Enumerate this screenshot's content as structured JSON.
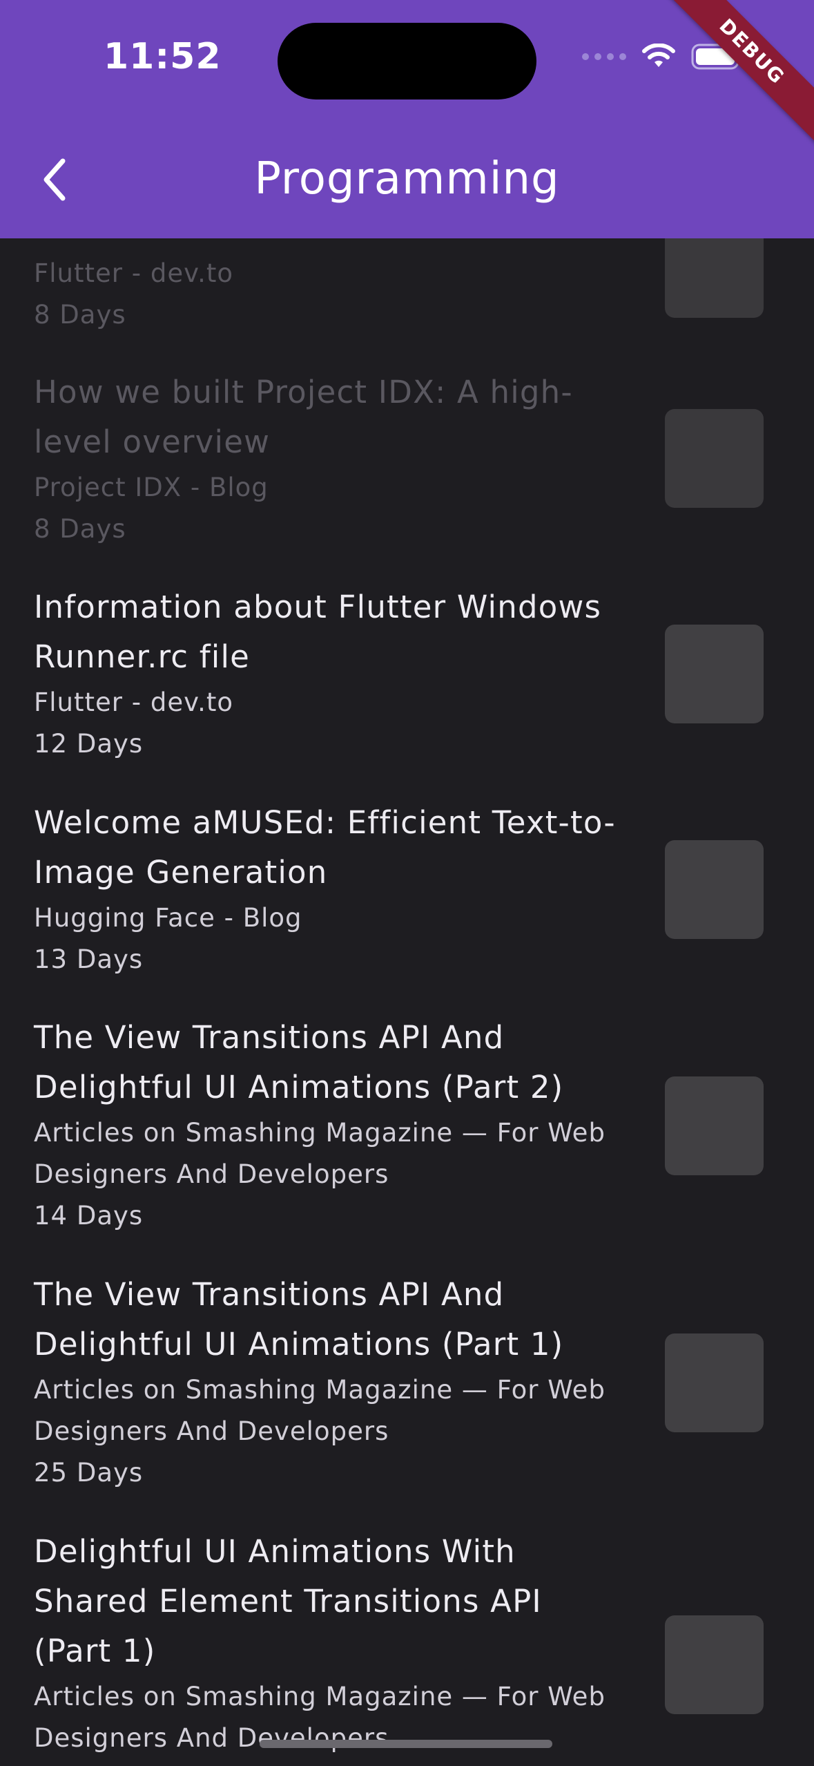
{
  "status_bar": {
    "time": "11:52"
  },
  "debug_banner": "DEBUG",
  "app_bar": {
    "title": "Programming"
  },
  "articles": [
    {
      "title": "",
      "source": "Flutter - dev.to",
      "age": "8 Days"
    },
    {
      "title": "How we built Project IDX: A high-level overview",
      "source": "Project IDX - Blog",
      "age": "8 Days"
    },
    {
      "title": "Information about Flutter Windows Runner.rc file",
      "source": "Flutter - dev.to",
      "age": "12 Days"
    },
    {
      "title": "Welcome aMUSEd: Efficient Text-to-Image Generation",
      "source": "Hugging Face - Blog",
      "age": "13 Days"
    },
    {
      "title": "The View Transitions API And Delightful UI Animations (Part 2)",
      "source": "Articles on Smashing Magazine — For Web Designers And Developers",
      "age": "14 Days"
    },
    {
      "title": "The View Transitions API And Delightful UI Animations (Part 1)",
      "source": "Articles on Smashing Magazine — For Web Designers And Developers",
      "age": "25 Days"
    },
    {
      "title": "Delightful UI Animations With Shared Element Transitions API (Part 1)",
      "source": "Articles on Smashing Magazine — For Web Designers And Developers",
      "age": ""
    }
  ],
  "colors": {
    "app_bar": "#6f46bd",
    "background": "#1e1d21",
    "thumbnail": "#414043",
    "debug_ribbon": "#8a1b34"
  }
}
